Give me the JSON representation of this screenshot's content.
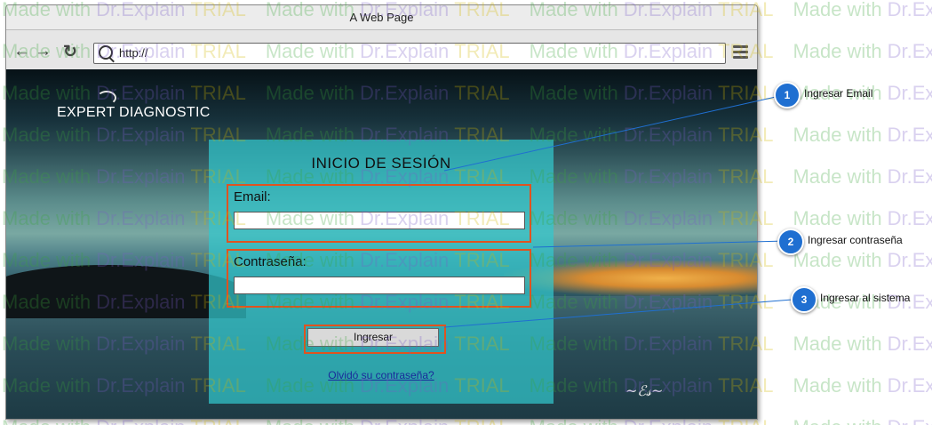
{
  "window": {
    "title": "A Web Page"
  },
  "toolbar": {
    "url": "http://",
    "icons": [
      "back-arrow-icon",
      "forward-arrow-icon",
      "reload-icon",
      "search-icon",
      "menu-icon"
    ]
  },
  "page": {
    "brand": "EXPERT DIAGNOSTIC",
    "login": {
      "title": "INICIO DE SESIÓN",
      "email_label": "Email:",
      "email_value": "",
      "password_label": "Contraseña:",
      "password_value": "",
      "submit_label": "Ingresar",
      "forgot_link": "Olvidó su contraseña?"
    }
  },
  "callouts": [
    {
      "number": "1",
      "label": "Ingresar Email"
    },
    {
      "number": "2",
      "label": "Ingresar contraseña"
    },
    {
      "number": "3",
      "label": "Ingresar al sistema"
    }
  ],
  "watermark": {
    "parts": [
      "Made",
      "with",
      "Dr.Explain",
      "TRIAL"
    ]
  },
  "colors": {
    "callout_badge": "#1f6fd1",
    "highlight_border": "#e0531f",
    "panel": "#32c8cd",
    "link": "#1a2a9a"
  }
}
